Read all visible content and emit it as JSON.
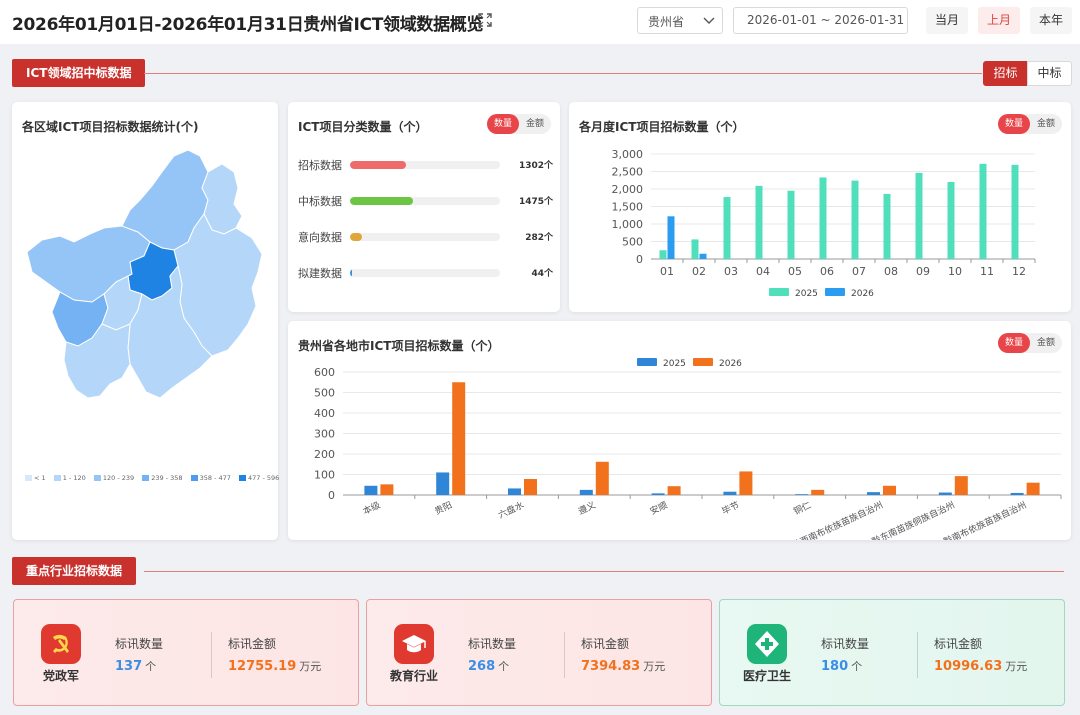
{
  "header": {
    "title": "2026年01月01日-2026年01月31日贵州省ICT领域数据概览",
    "province_select": "贵州省",
    "date_range": "2026-01-01 ~ 2026-01-31",
    "periods": [
      {
        "label": "当月",
        "active": false
      },
      {
        "label": "上月",
        "active": true
      },
      {
        "label": "本年",
        "active": false
      }
    ]
  },
  "section1": {
    "title": "ICT领域招中标数据",
    "tabs": [
      {
        "label": "招标",
        "active": true
      },
      {
        "label": "中标",
        "active": false
      }
    ]
  },
  "map_card": {
    "title": "各区域ICT项目招标数据统计(个)",
    "legend": [
      {
        "label": "< 1",
        "color": "#d6e9fb"
      },
      {
        "label": "1 - 120",
        "color": "#b4d6f8"
      },
      {
        "label": "120 - 239",
        "color": "#95c5f6"
      },
      {
        "label": "239 - 358",
        "color": "#74b2f3"
      },
      {
        "label": "358 - 477",
        "color": "#4d9ced"
      },
      {
        "label": "477 - 596",
        "color": "#1f83e4"
      }
    ]
  },
  "category_card": {
    "title": "ICT项目分类数量（个）",
    "toggle": [
      "数量",
      "金额"
    ],
    "max": 1475,
    "rows": [
      {
        "label": "招标数据",
        "value": 1302,
        "value_text": "1302个",
        "color": "#ef6b6b"
      },
      {
        "label": "中标数据",
        "value": 1475,
        "value_text": "1475个",
        "color": "#6cc644"
      },
      {
        "label": "意向数据",
        "value": 282,
        "value_text": "282个",
        "color": "#e0a63a"
      },
      {
        "label": "拟建数据",
        "value": 44,
        "value_text": "44个",
        "color": "#3a8ee6"
      }
    ]
  },
  "monthly_card": {
    "title": "各月度ICT项目招标数量（个）",
    "toggle": [
      "数量",
      "金额"
    ]
  },
  "city_card": {
    "title": "贵州省各地市ICT项目招标数量（个）",
    "toggle": [
      "数量",
      "金额"
    ]
  },
  "chart_data": [
    {
      "type": "bar",
      "title": "各月度ICT项目招标数量（个）",
      "categories": [
        "01",
        "02",
        "03",
        "04",
        "05",
        "06",
        "07",
        "08",
        "09",
        "10",
        "11",
        "12"
      ],
      "ylim": [
        0,
        3000
      ],
      "yticks": [
        "0",
        "500",
        "1,000",
        "1,500",
        "2,000",
        "2,500",
        "3,000"
      ],
      "series": [
        {
          "name": "2025",
          "color": "#4fe0bb",
          "values": [
            250,
            560,
            1770,
            2090,
            1950,
            2330,
            2240,
            1860,
            2460,
            2200,
            2720,
            2690
          ]
        },
        {
          "name": "2026",
          "color": "#2a9cf2",
          "values": [
            1220,
            150,
            null,
            null,
            null,
            null,
            null,
            null,
            null,
            null,
            null,
            null
          ]
        }
      ],
      "legend": "bottom"
    },
    {
      "type": "bar",
      "title": "贵州省各地市ICT项目招标数量（个）",
      "categories": [
        "本级",
        "贵阳",
        "六盘水",
        "遵义",
        "安顺",
        "毕节",
        "铜仁",
        "黔西南布依族苗族自治州",
        "黔东南苗族侗族自治州",
        "黔南布依族苗族自治州"
      ],
      "ylim": [
        0,
        600
      ],
      "yticks": [
        "0",
        "100",
        "200",
        "300",
        "400",
        "500",
        "600"
      ],
      "series": [
        {
          "name": "2025",
          "color": "#2f86d6",
          "values": [
            45,
            110,
            32,
            25,
            8,
            16,
            4,
            14,
            12,
            10
          ]
        },
        {
          "name": "2026",
          "color": "#f2711c",
          "values": [
            52,
            550,
            78,
            162,
            43,
            115,
            25,
            45,
            92,
            60
          ]
        }
      ],
      "legend": "top"
    }
  ],
  "section2": {
    "title": "重点行业招标数据"
  },
  "industries": [
    {
      "name": "党政军",
      "count_label": "标讯数量",
      "count": "137",
      "count_unit": "个",
      "amount_label": "标讯金额",
      "amount": "12755.19",
      "amount_unit": "万元",
      "theme": "red",
      "icon": "party-emblem-icon"
    },
    {
      "name": "教育行业",
      "count_label": "标讯数量",
      "count": "268",
      "count_unit": "个",
      "amount_label": "标讯金额",
      "amount": "7394.83",
      "amount_unit": "万元",
      "theme": "red",
      "icon": "graduation-cap-icon"
    },
    {
      "name": "医疗卫生",
      "count_label": "标讯数量",
      "count": "180",
      "count_unit": "个",
      "amount_label": "标讯金额",
      "amount": "10996.63",
      "amount_unit": "万元",
      "theme": "green",
      "icon": "medical-cross-icon"
    }
  ]
}
